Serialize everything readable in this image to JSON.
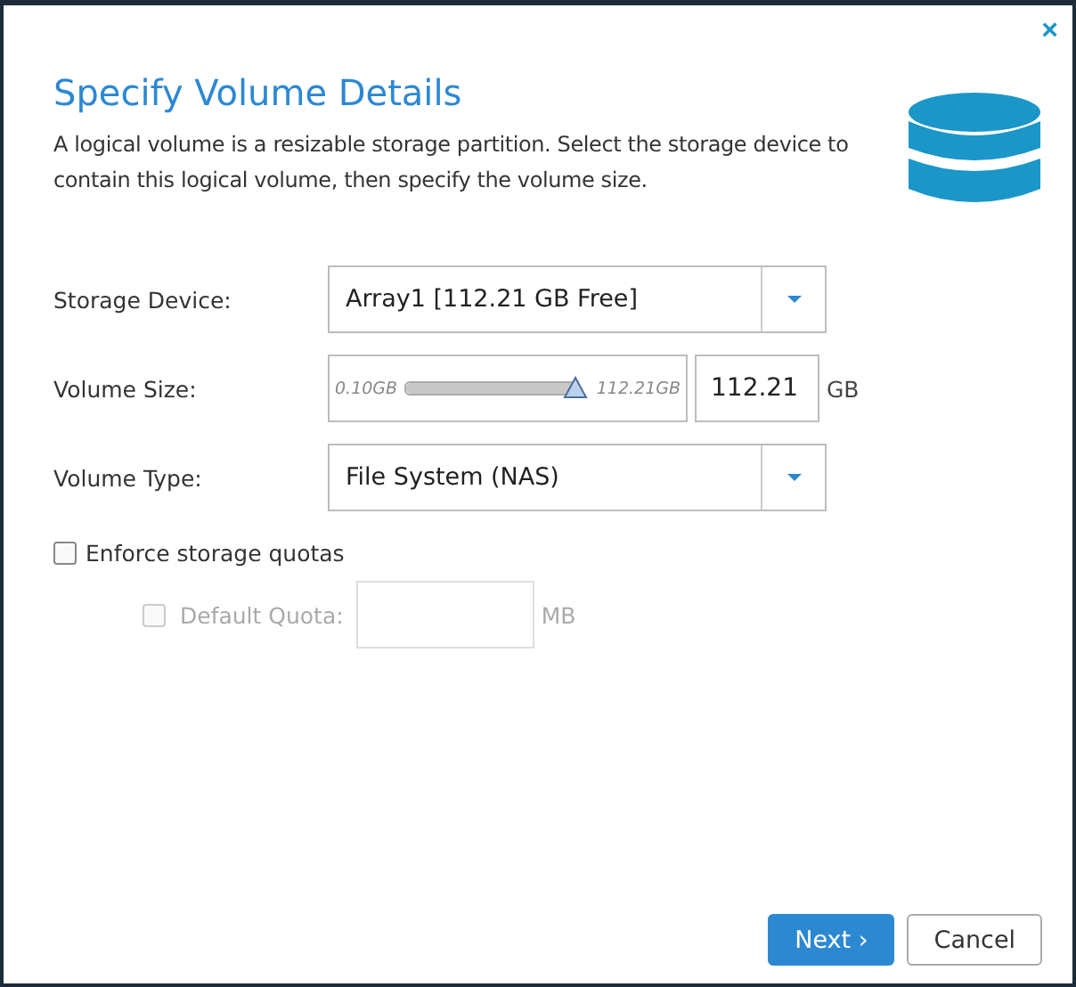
{
  "dialog": {
    "close": "×",
    "title": "Specify Volume Details",
    "description": "A logical volume is a resizable storage partition. Select the storage device to contain this logical volume, then specify the volume size."
  },
  "fields": [
    {
      "kind": "select",
      "label": "Storage Device:",
      "value": "Array1 [112.21 GB Free]"
    },
    {
      "kind": "slider",
      "label": "Volume Size:",
      "min_label": "0.10GB",
      "max_label": "112.21GB",
      "level": 1,
      "value": "112.21",
      "unit": "GB"
    },
    {
      "kind": "select",
      "label": "Volume Type:",
      "value": "File System (NAS)"
    }
  ],
  "enforce": {
    "label": "Enforce storage quotas",
    "checked": false
  },
  "quota": {
    "label": "Default Quota:",
    "checked": false,
    "disabled": true,
    "unit": "MB"
  },
  "buttons": [
    {
      "label": "Next ›",
      "kind": "primary"
    },
    {
      "label": "Cancel",
      "kind": "secondary"
    }
  ]
}
